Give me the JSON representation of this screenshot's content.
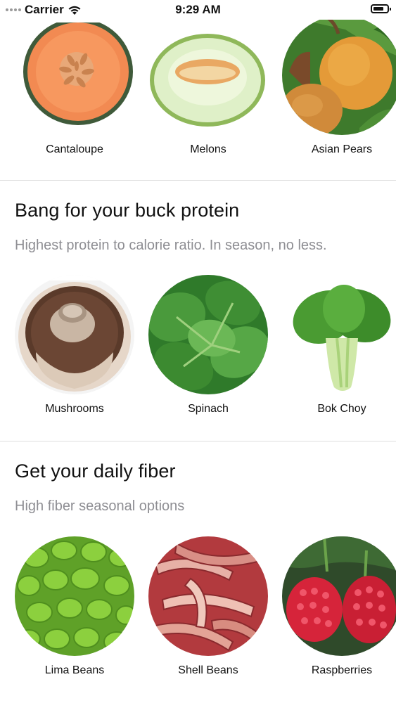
{
  "status_bar": {
    "carrier": "Carrier",
    "time": "9:29 AM"
  },
  "sections": [
    {
      "title": "",
      "subtitle": "",
      "items": [
        {
          "label": "Cantaloupe",
          "image": "cantaloupe-image"
        },
        {
          "label": "Melons",
          "image": "melon-image"
        },
        {
          "label": "Asian Pears",
          "image": "asian-pear-image"
        }
      ]
    },
    {
      "title": "Bang for your buck protein",
      "subtitle": "Highest protein to calorie ratio. In season, no less.",
      "items": [
        {
          "label": "Mushrooms",
          "image": "mushroom-image"
        },
        {
          "label": "Spinach",
          "image": "spinach-image"
        },
        {
          "label": "Bok Choy",
          "image": "bok-choy-image"
        }
      ]
    },
    {
      "title": "Get your daily fiber",
      "subtitle": "High fiber seasonal options",
      "items": [
        {
          "label": "Lima Beans",
          "image": "lima-beans-image"
        },
        {
          "label": "Shell Beans",
          "image": "shell-beans-image"
        },
        {
          "label": "Raspberries",
          "image": "raspberries-image"
        }
      ]
    }
  ]
}
